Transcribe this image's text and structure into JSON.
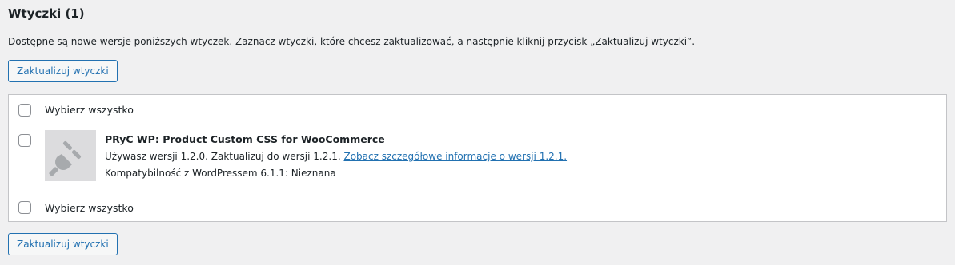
{
  "section": {
    "title": "Wtyczki (1)",
    "description": "Dostępne są nowe wersje poniższych wtyczek. Zaznacz wtyczki, które chcesz zaktualizować, a następnie kliknij przycisk „Zaktualizuj wtyczki”."
  },
  "buttons": {
    "update_top": "Zaktualizuj wtyczki",
    "update_bottom": "Zaktualizuj wtyczki"
  },
  "table": {
    "select_all_top": "Wybierz wszystko",
    "select_all_bottom": "Wybierz wszystko",
    "plugin": {
      "name": "PRyC WP: Product Custom CSS for WooCommerce",
      "version_text": "Używasz wersji 1.2.0. Zaktualizuj do wersji 1.2.1.",
      "details_link": "Zobacz szczegółowe informacje o wersji 1.2.1.",
      "compatibility": "Kompatybilność z WordPressem 6.1.1: Nieznana",
      "thumbnail_icon": "plugin-plug-icon"
    }
  },
  "colors": {
    "accent": "#2271b1",
    "background": "#f0f0f1",
    "border": "#c3c4c7"
  }
}
